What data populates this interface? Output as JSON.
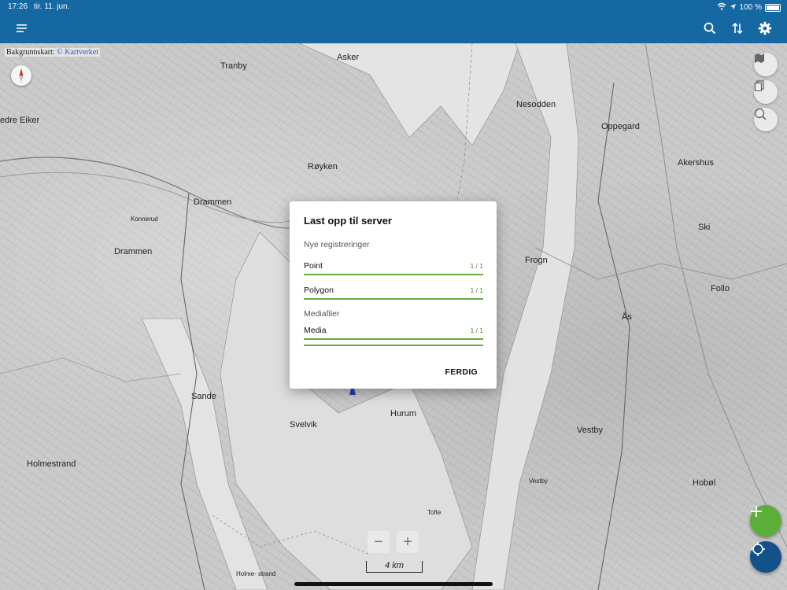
{
  "status_bar": {
    "time": "17:26",
    "date": "tir. 11. jun.",
    "battery": "100 %"
  },
  "app_bar": {
    "icons": [
      "menu-icon",
      "search-icon",
      "sync-icon",
      "gear-icon"
    ]
  },
  "map": {
    "attribution_prefix": "Bakgrunnskart:",
    "attribution_link": "© Kartverket",
    "scale_label": "4 km",
    "places": [
      {
        "id": "asker",
        "label": "Asker"
      },
      {
        "id": "drammen1",
        "label": "Drammen"
      },
      {
        "id": "drammen2",
        "label": "Drammen"
      },
      {
        "id": "royken",
        "label": "Røyken"
      },
      {
        "id": "nesodden",
        "label": "Nesodden"
      },
      {
        "id": "oppegard",
        "label": "Oppegard"
      },
      {
        "id": "akershus",
        "label": "Akershus"
      },
      {
        "id": "ski",
        "label": "Ski"
      },
      {
        "id": "frogn",
        "label": "Frogn"
      },
      {
        "id": "as",
        "label": "Ås"
      },
      {
        "id": "follo",
        "label": "Follo"
      },
      {
        "id": "sande",
        "label": "Sande"
      },
      {
        "id": "svelvik",
        "label": "Svelvik"
      },
      {
        "id": "hurum",
        "label": "Hurum"
      },
      {
        "id": "holmestrand",
        "label": "Holmestrand"
      },
      {
        "id": "vestby",
        "label": "Vestby"
      },
      {
        "id": "hobol",
        "label": "Hobøl"
      },
      {
        "id": "tofte",
        "label": "Tofte"
      },
      {
        "id": "nedre-eiker",
        "label": "edre Eiker"
      },
      {
        "id": "konnerud",
        "label": "Konnerud"
      },
      {
        "id": "tranby",
        "label": "Tranby"
      },
      {
        "id": "holmestrand2",
        "label": "Holme-\nstrand"
      },
      {
        "id": "vestby2",
        "label": "Vestby"
      }
    ]
  },
  "dialog": {
    "title": "Last opp til server",
    "new_registrations_label": "Nye registreringer",
    "media_section_label": "Mediafiler",
    "rows": [
      {
        "label": "Point",
        "count": "1 / 1",
        "progress": 1.0
      },
      {
        "label": "Polygon",
        "count": "1 / 1",
        "progress": 1.0
      },
      {
        "label": "Media",
        "count": "1 / 1",
        "progress": 1.0
      }
    ],
    "done_label": "FERDIG"
  },
  "colors": {
    "app_bar": "#1668a3",
    "accent_green": "#5cae3a",
    "progress_green": "#6aa843",
    "locate_button": "#14508a"
  }
}
